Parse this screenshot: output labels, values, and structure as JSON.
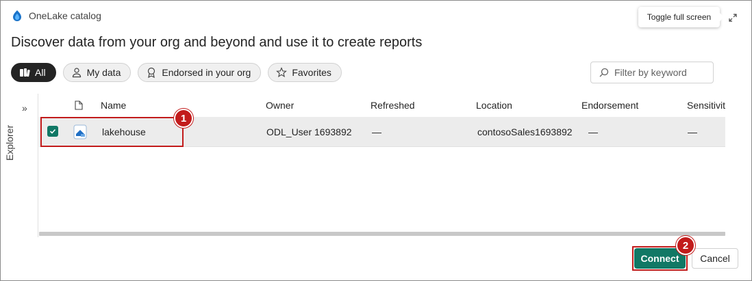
{
  "app": {
    "title": "OneLake catalog",
    "logo_icon": "onelake-logo-icon",
    "expand_icon": "expand-icon"
  },
  "tooltip": {
    "text": "Toggle full screen"
  },
  "headline": "Discover data from your org and beyond and use it to create reports",
  "chips": [
    {
      "label": "All",
      "icon": "all-items-icon",
      "selected": true
    },
    {
      "label": "My data",
      "icon": "person-icon",
      "selected": false
    },
    {
      "label": "Endorsed in your org",
      "icon": "ribbon-icon",
      "selected": false
    },
    {
      "label": "Favorites",
      "icon": "star-icon",
      "selected": false
    }
  ],
  "filter": {
    "placeholder": "Filter by keyword",
    "icon": "search-icon"
  },
  "explorer": {
    "label": "Explorer",
    "icon": "chevron-double-right-icon"
  },
  "table": {
    "columns": [
      "Name",
      "Owner",
      "Refreshed",
      "Location",
      "Endorsement",
      "Sensitivit"
    ],
    "type_column_icon": "document-icon",
    "rows": [
      {
        "selected": true,
        "icon": "lakehouse-icon",
        "name": "lakehouse",
        "owner": "ODL_User 1693892",
        "refreshed": "—",
        "location": "contosoSales1693892",
        "endorsement": "—",
        "sensitivity": "—"
      }
    ]
  },
  "markers": [
    "1",
    "2"
  ],
  "buttons": {
    "connect": "Connect",
    "cancel": "Cancel"
  },
  "colors": {
    "accent": "#117865",
    "highlight": "#c21b1b",
    "active_chip": "#242424"
  }
}
